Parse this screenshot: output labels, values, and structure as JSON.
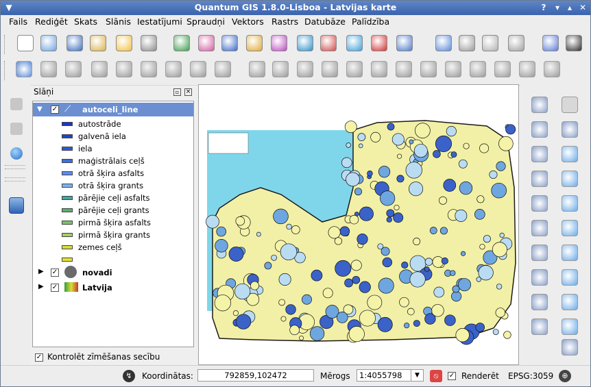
{
  "window": {
    "title": "Quantum GIS 1.8.0-Lisboa - Latvijas karte"
  },
  "menubar": [
    "Fails",
    "Rediģēt",
    "Skats",
    "Slānis",
    "Iestatījumi",
    "Spraudņi",
    "Vektors",
    "Rastrs",
    "Datubāze",
    "Palīdzība"
  ],
  "layers_panel": {
    "title": "Slāņi",
    "layers": [
      {
        "name": "autoceli_line",
        "checked": true,
        "expanded": true,
        "selected": true,
        "classes": [
          {
            "label": "autostrāde",
            "color": "#1a36c8"
          },
          {
            "label": "galvenā iela",
            "color": "#1c44d0"
          },
          {
            "label": "iela",
            "color": "#2c58e0"
          },
          {
            "label": "maģistrālais ceļš",
            "color": "#3d6fe5"
          },
          {
            "label": "otrā šķira asfalts",
            "color": "#5d8df0"
          },
          {
            "label": "otrā šķira grants",
            "color": "#7ab4ee"
          },
          {
            "label": "pārējie ceļi asfalts",
            "color": "#3fa7a2"
          },
          {
            "label": "pārējie ceļi grants",
            "color": "#58b06f"
          },
          {
            "label": "pirmā šķira asfalts",
            "color": "#7ec16a"
          },
          {
            "label": "pirmā šķira grants",
            "color": "#a5cf66"
          },
          {
            "label": "zemes ceļš",
            "color": "#d6dd3c"
          },
          {
            "label": "",
            "color": "#e6e234"
          }
        ]
      },
      {
        "name": "novadi",
        "checked": true,
        "expanded": false
      },
      {
        "name": "Latvija",
        "checked": true,
        "expanded": false
      }
    ],
    "render_order_label": "Kontrolēt zīmēšanas secību",
    "render_order_checked": true
  },
  "statusbar": {
    "coords_label": "Koordinātas:",
    "coords_value": "792859,102472",
    "scale_label": "Mērogs",
    "scale_value": "1:4055798",
    "render_label": "Renderēt",
    "render_checked": true,
    "crs": "EPSG:3059"
  },
  "icons": {
    "toolbar1": [
      "new-project-icon",
      "open-project-icon",
      "save-project-icon",
      "save-as-icon",
      "new-print-composer-icon",
      "print-icon",
      "add-raster-layer-icon",
      "add-vector-layer-icon",
      "add-postgis-layer-icon",
      "add-spatialite-layer-icon",
      "add-mssql-layer-icon",
      "add-wms-layer-icon",
      "add-wfs-layer-icon",
      "new-shapefile-icon",
      "remove-layer-icon",
      "add-delimited-text-icon",
      "label-icon",
      "pin-labels-icon",
      "move-label-icon",
      "rotate-label-icon",
      "help-icon",
      "whats-this-icon"
    ],
    "toolbar2": [
      "toggle-editing-icon",
      "save-edits-icon",
      "add-feature-icon",
      "move-feature-icon",
      "node-tool-icon",
      "delete-selected-icon",
      "cut-features-icon",
      "copy-features-icon",
      "paste-features-icon",
      "undo-icon",
      "redo-icon",
      "simplify-feature-icon",
      "add-ring-icon",
      "add-part-icon",
      "delete-ring-icon",
      "delete-part-icon",
      "reshape-features-icon",
      "offset-curve-icon",
      "split-features-icon",
      "merge-features-icon",
      "merge-attributes-icon",
      "rotate-point-symbols-icon"
    ],
    "right_dock": [
      "identify-icon",
      "pan-icon",
      "action-icon",
      "pan-to-selection-icon",
      "select-icon",
      "zoom-in-icon",
      "deselect-icon",
      "zoom-out-icon",
      "attribute-table-icon",
      "zoom-full-icon",
      "measure-icon",
      "zoom-to-layer-icon",
      "map-tips-icon",
      "zoom-selection-icon",
      "new-bookmark-icon",
      "zoom-native-icon",
      "show-bookmarks-icon",
      "zoom-last-icon",
      "text-annotation-icon",
      "zoom-next-icon",
      "refresh-icon"
    ]
  },
  "map": {
    "sea_color": "#7fd6ea",
    "land_colors": [
      "#f4f3a8",
      "#b9dcf3",
      "#6ea6e0",
      "#3a62c8"
    ]
  }
}
